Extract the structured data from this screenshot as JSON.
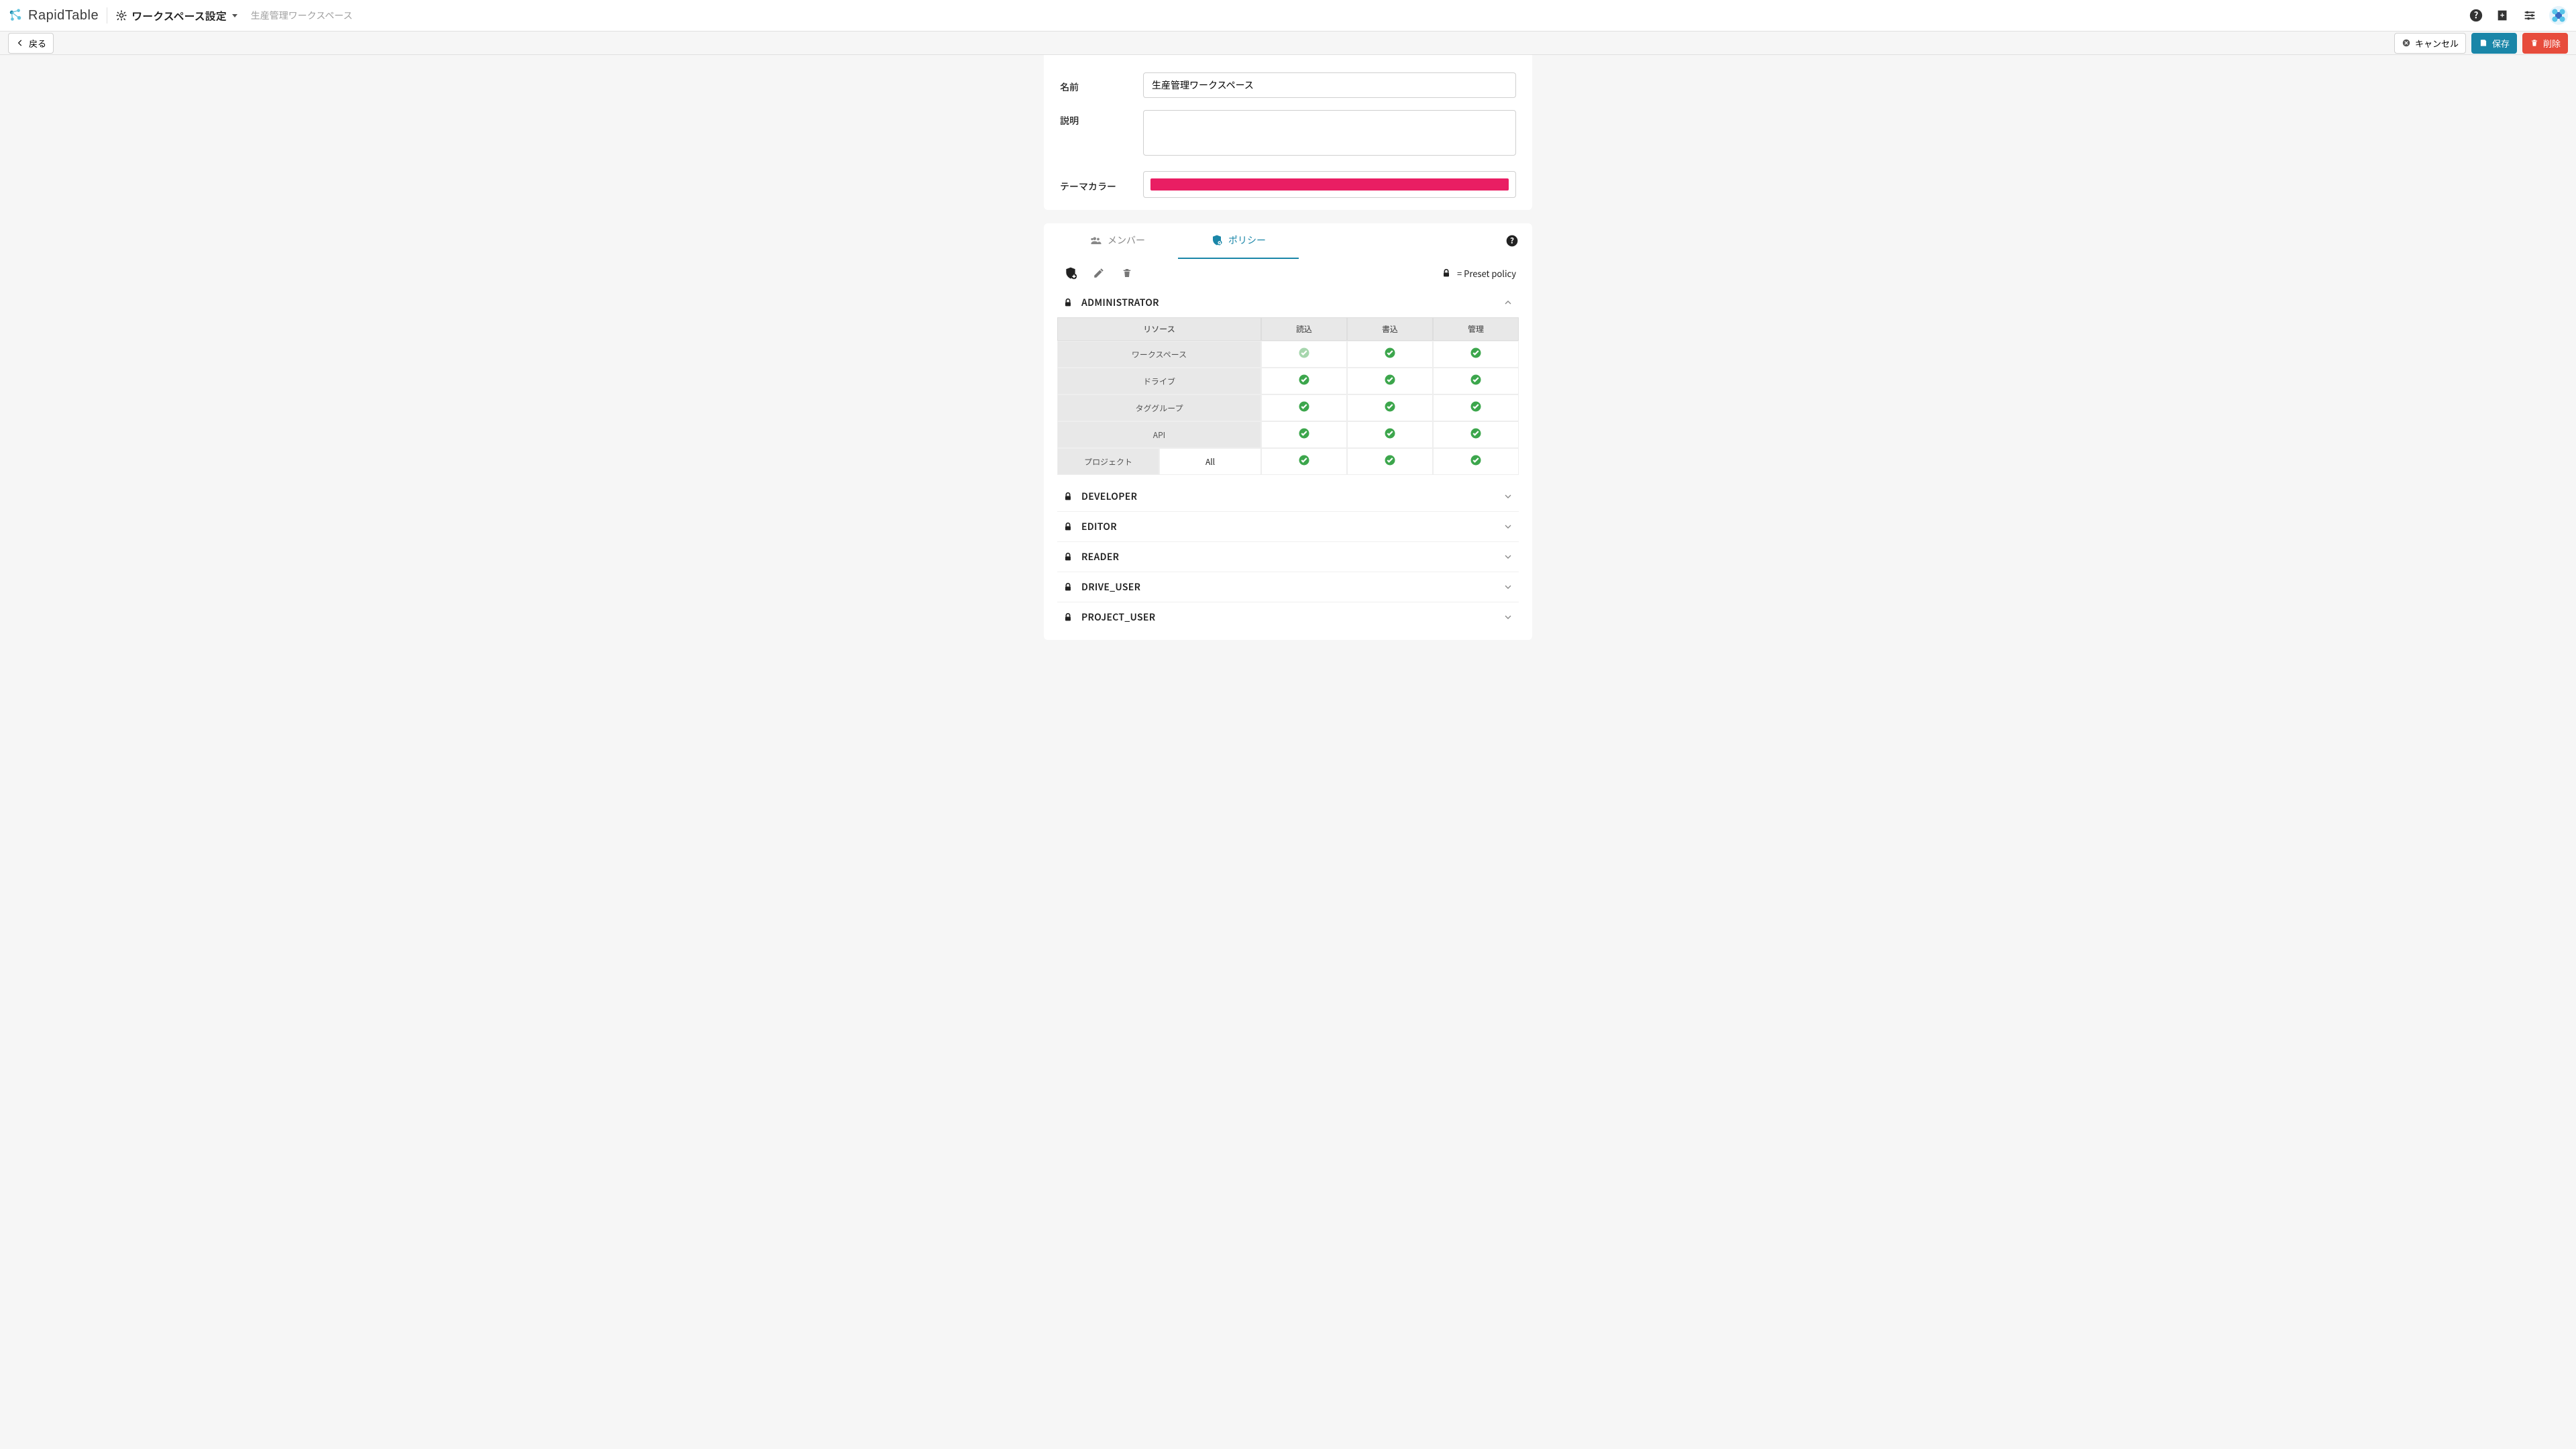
{
  "brand": {
    "name": "RapidTable"
  },
  "header": {
    "settings_label": "ワークスペース設定",
    "workspace_name": "生産管理ワークスペース"
  },
  "actionbar": {
    "back": "戻る",
    "cancel": "キャンセル",
    "save": "保存",
    "delete": "削除"
  },
  "form": {
    "name_label": "名前",
    "name_value": "生産管理ワークスペース",
    "desc_label": "説明",
    "desc_value": "",
    "theme_label": "テーマカラー",
    "theme_color": "#e91e63"
  },
  "tabs": {
    "members": "メンバー",
    "policies": "ポリシー"
  },
  "legend": {
    "preset": "= Preset policy"
  },
  "perm_header": {
    "resource": "リソース",
    "read": "読込",
    "write": "書込",
    "manage": "管理"
  },
  "admin": {
    "name": "ADMINISTRATOR",
    "rows": [
      {
        "res": "ワークスペース",
        "sub": null,
        "read": "faded",
        "write": "on",
        "manage": "on"
      },
      {
        "res": "ドライブ",
        "sub": null,
        "read": "on",
        "write": "on",
        "manage": "on"
      },
      {
        "res": "タググループ",
        "sub": null,
        "read": "on",
        "write": "on",
        "manage": "on"
      },
      {
        "res": "API",
        "sub": null,
        "read": "on",
        "write": "on",
        "manage": "on"
      },
      {
        "res": "プロジェクト",
        "sub": "All",
        "read": "on",
        "write": "on",
        "manage": "on"
      }
    ]
  },
  "other_policies": [
    {
      "name": "DEVELOPER"
    },
    {
      "name": "EDITOR"
    },
    {
      "name": "READER"
    },
    {
      "name": "DRIVE_USER"
    },
    {
      "name": "PROJECT_USER"
    }
  ]
}
